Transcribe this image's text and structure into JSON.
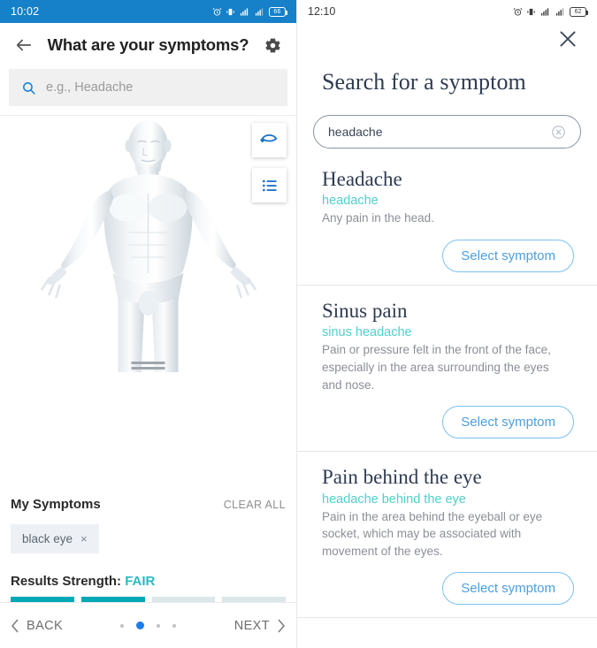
{
  "left": {
    "status": {
      "time": "10:02",
      "battery_level": "66",
      "icons": [
        "alarm-icon",
        "vibrate-icon",
        "signal-icon",
        "signal-icon",
        "battery-icon"
      ]
    },
    "appbar": {
      "back_icon": "arrow-left-icon",
      "title": "What are your symptoms?",
      "settings_icon": "gear-icon"
    },
    "search": {
      "icon": "search-icon",
      "value": "",
      "placeholder": "e.g., Headache"
    },
    "float_buttons": [
      {
        "name": "rotate-model-button",
        "icon": "rotate-icon"
      },
      {
        "name": "list-view-button",
        "icon": "list-icon"
      }
    ],
    "model": {
      "alt": "3d-body-model",
      "handle": "drag-handle"
    },
    "symptoms": {
      "heading": "My Symptoms",
      "clear_all": "CLEAR ALL",
      "chips": [
        {
          "label": "black eye",
          "remove": "×"
        }
      ]
    },
    "strength": {
      "label": "Results Strength:",
      "value": "FAIR",
      "segments_total": 4,
      "segments_filled": 2,
      "fill_color": "#00a8b5",
      "empty_color": "#dce7ea"
    },
    "bottom_nav": {
      "back_label": "BACK",
      "next_label": "NEXT",
      "back_icon": "chevron-left-icon",
      "next_icon": "chevron-right-icon",
      "dots_total": 4,
      "active_dot": 2,
      "active_color": "#1c7ee8"
    }
  },
  "right": {
    "status": {
      "time": "12:10",
      "battery_level": "62",
      "icons": [
        "alarm-icon",
        "vibrate-icon",
        "signal-icon",
        "signal-icon",
        "battery-icon"
      ]
    },
    "close_icon": "close-icon",
    "title": "Search for a symptom",
    "search": {
      "value": "headache",
      "placeholder": "Search for a symptom",
      "clear_icon": "clear-circle-icon"
    },
    "results": [
      {
        "name": "Headache",
        "alias": "headache",
        "description": "Any pain in the head.",
        "button": "Select symptom"
      },
      {
        "name": "Sinus pain",
        "alias": "sinus headache",
        "description": "Pain or pressure felt in the front of the face, especially in the area surrounding the eyes and nose.",
        "button": "Select symptom"
      },
      {
        "name": "Pain behind the eye",
        "alias": "headache behind the eye",
        "description": "Pain in the area behind the eyeball or eye socket, which may be associated with movement of the eyes.",
        "button": "Select symptom"
      }
    ],
    "colors": {
      "title": "#2e3b52",
      "alias": "#4fd0cd",
      "button": "#4a9fe0"
    }
  }
}
